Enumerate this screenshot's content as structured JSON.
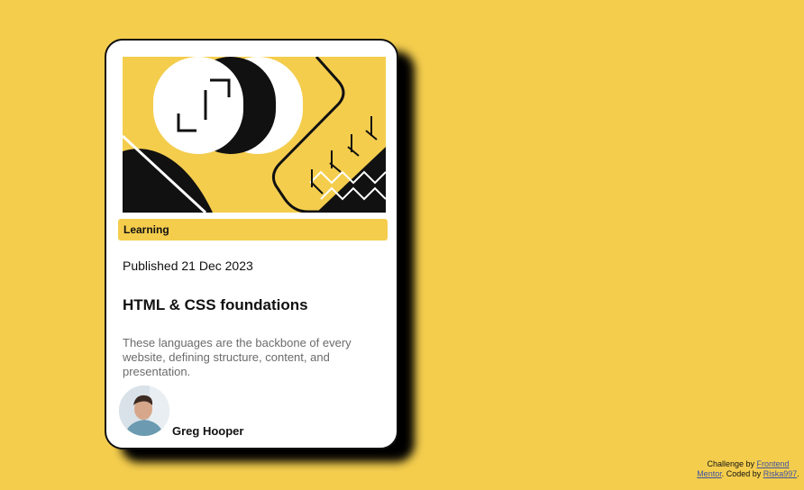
{
  "card": {
    "image_alt": "illustration-article",
    "category": "Learning",
    "published": "Published 21 Dec 2023",
    "title": "HTML & CSS foundations",
    "description": "These languages are the backbone of every website, defining structure, content, and presentation.",
    "author": {
      "name": "Greg Hooper",
      "avatar_icon": "avatar-photo"
    }
  },
  "attribution": {
    "prefix": "Challenge by",
    "link1": "Frontend Mentor",
    "middle": ". Coded by",
    "link2": "Riska997",
    "suffix": "."
  },
  "colors": {
    "background": "#f4cd4d",
    "card": "#ffffff",
    "text": "#111111",
    "muted": "#6b6b6b",
    "link": "#3e52a3"
  }
}
